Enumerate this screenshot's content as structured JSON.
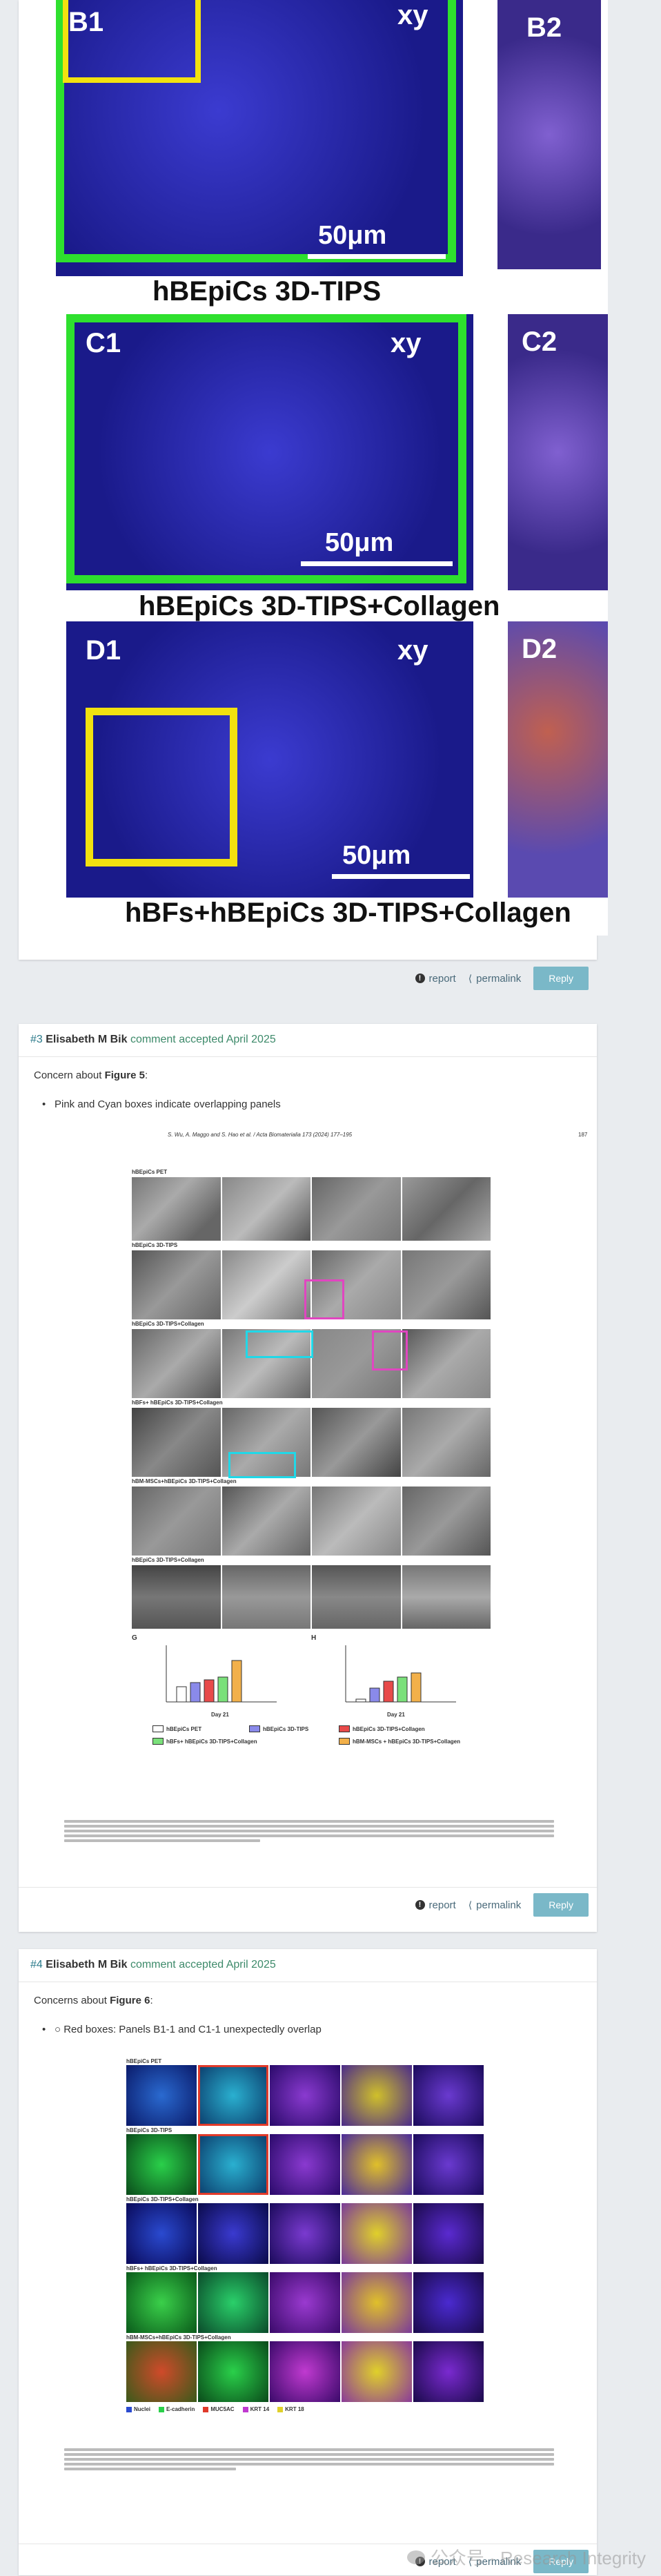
{
  "card1": {
    "figure_labels": [
      "B1",
      "xy",
      "B2",
      "C1",
      "xy",
      "C2",
      "D1",
      "xy",
      "D2"
    ],
    "scale_bars": [
      "50μm",
      "50μm",
      "50μm"
    ],
    "panel_titles": [
      "hBEpiCs 3D-TIPS",
      "hBEpiCs 3D-TIPS+Collagen",
      "hBFs+hBEpiCs 3D-TIPS+Collagen"
    ],
    "report_label": "report",
    "permalink_label": "permalink",
    "reply_label": "Reply"
  },
  "card2": {
    "number": "#3",
    "author": "Elisabeth M Bik",
    "meta": "comment accepted April 2025",
    "concern_prefix": "Concern about ",
    "concern_figure": "Figure 5",
    "concern_suffix": ":",
    "bullet": "Pink and Cyan boxes indicate overlapping panels",
    "journal_header": "S. Wu, A. Maggo and S. Hao et al. / Acta Biomaterialia 173 (2024) 177–195",
    "page_number": "187",
    "row_labels": [
      "hBEpiCs PET",
      "hBEpiCs 3D-TIPS",
      "hBEpiCs 3D-TIPS+Collagen",
      "hBFs+ hBEpiCs 3D-TIPS+Collagen",
      "hBM-MSCs+hBEpiCs 3D-TIPS+Collagen",
      "hBEpiCs 3D-TIPS+Collagen"
    ],
    "chart_labels": [
      "G",
      "H",
      "Day 21",
      "Day 21"
    ],
    "legend": [
      "hBEpiCs PET",
      "hBEpiCs 3D-TIPS",
      "hBEpiCs 3D-TIPS+Collagen",
      "hBFs+ hBEpiCs 3D-TIPS+Collagen",
      "hBM-MSCs + hBEpiCs 3D-TIPS+Collagen"
    ],
    "report_label": "report",
    "permalink_label": "permalink",
    "reply_label": "Reply"
  },
  "card3": {
    "number": "#4",
    "author": "Elisabeth M Bik",
    "meta": "comment accepted April 2025",
    "concern_prefix": "Concerns about ",
    "concern_figure": "Figure 6",
    "concern_suffix": ":",
    "bullet": "○ Red boxes: Panels B1-1 and C1-1 unexpectedly overlap",
    "row_labels": [
      "hBEpiCs PET",
      "hBEpiCs 3D-TIPS",
      "hBEpiCs 3D-TIPS+Collagen",
      "hBFs+ hBEpiCs 3D-TIPS+Collagen",
      "hBM-MSCs+hBEpiCs 3D-TIPS+Collagen"
    ],
    "legend": [
      "Nuclei",
      "E-cadherin",
      "MUC5AC",
      "KRT 14",
      "KRT 18"
    ],
    "report_label": "report",
    "permalink_label": "permalink",
    "reply_label": "Reply",
    "watermark": "公众号 · Research Integrity"
  }
}
